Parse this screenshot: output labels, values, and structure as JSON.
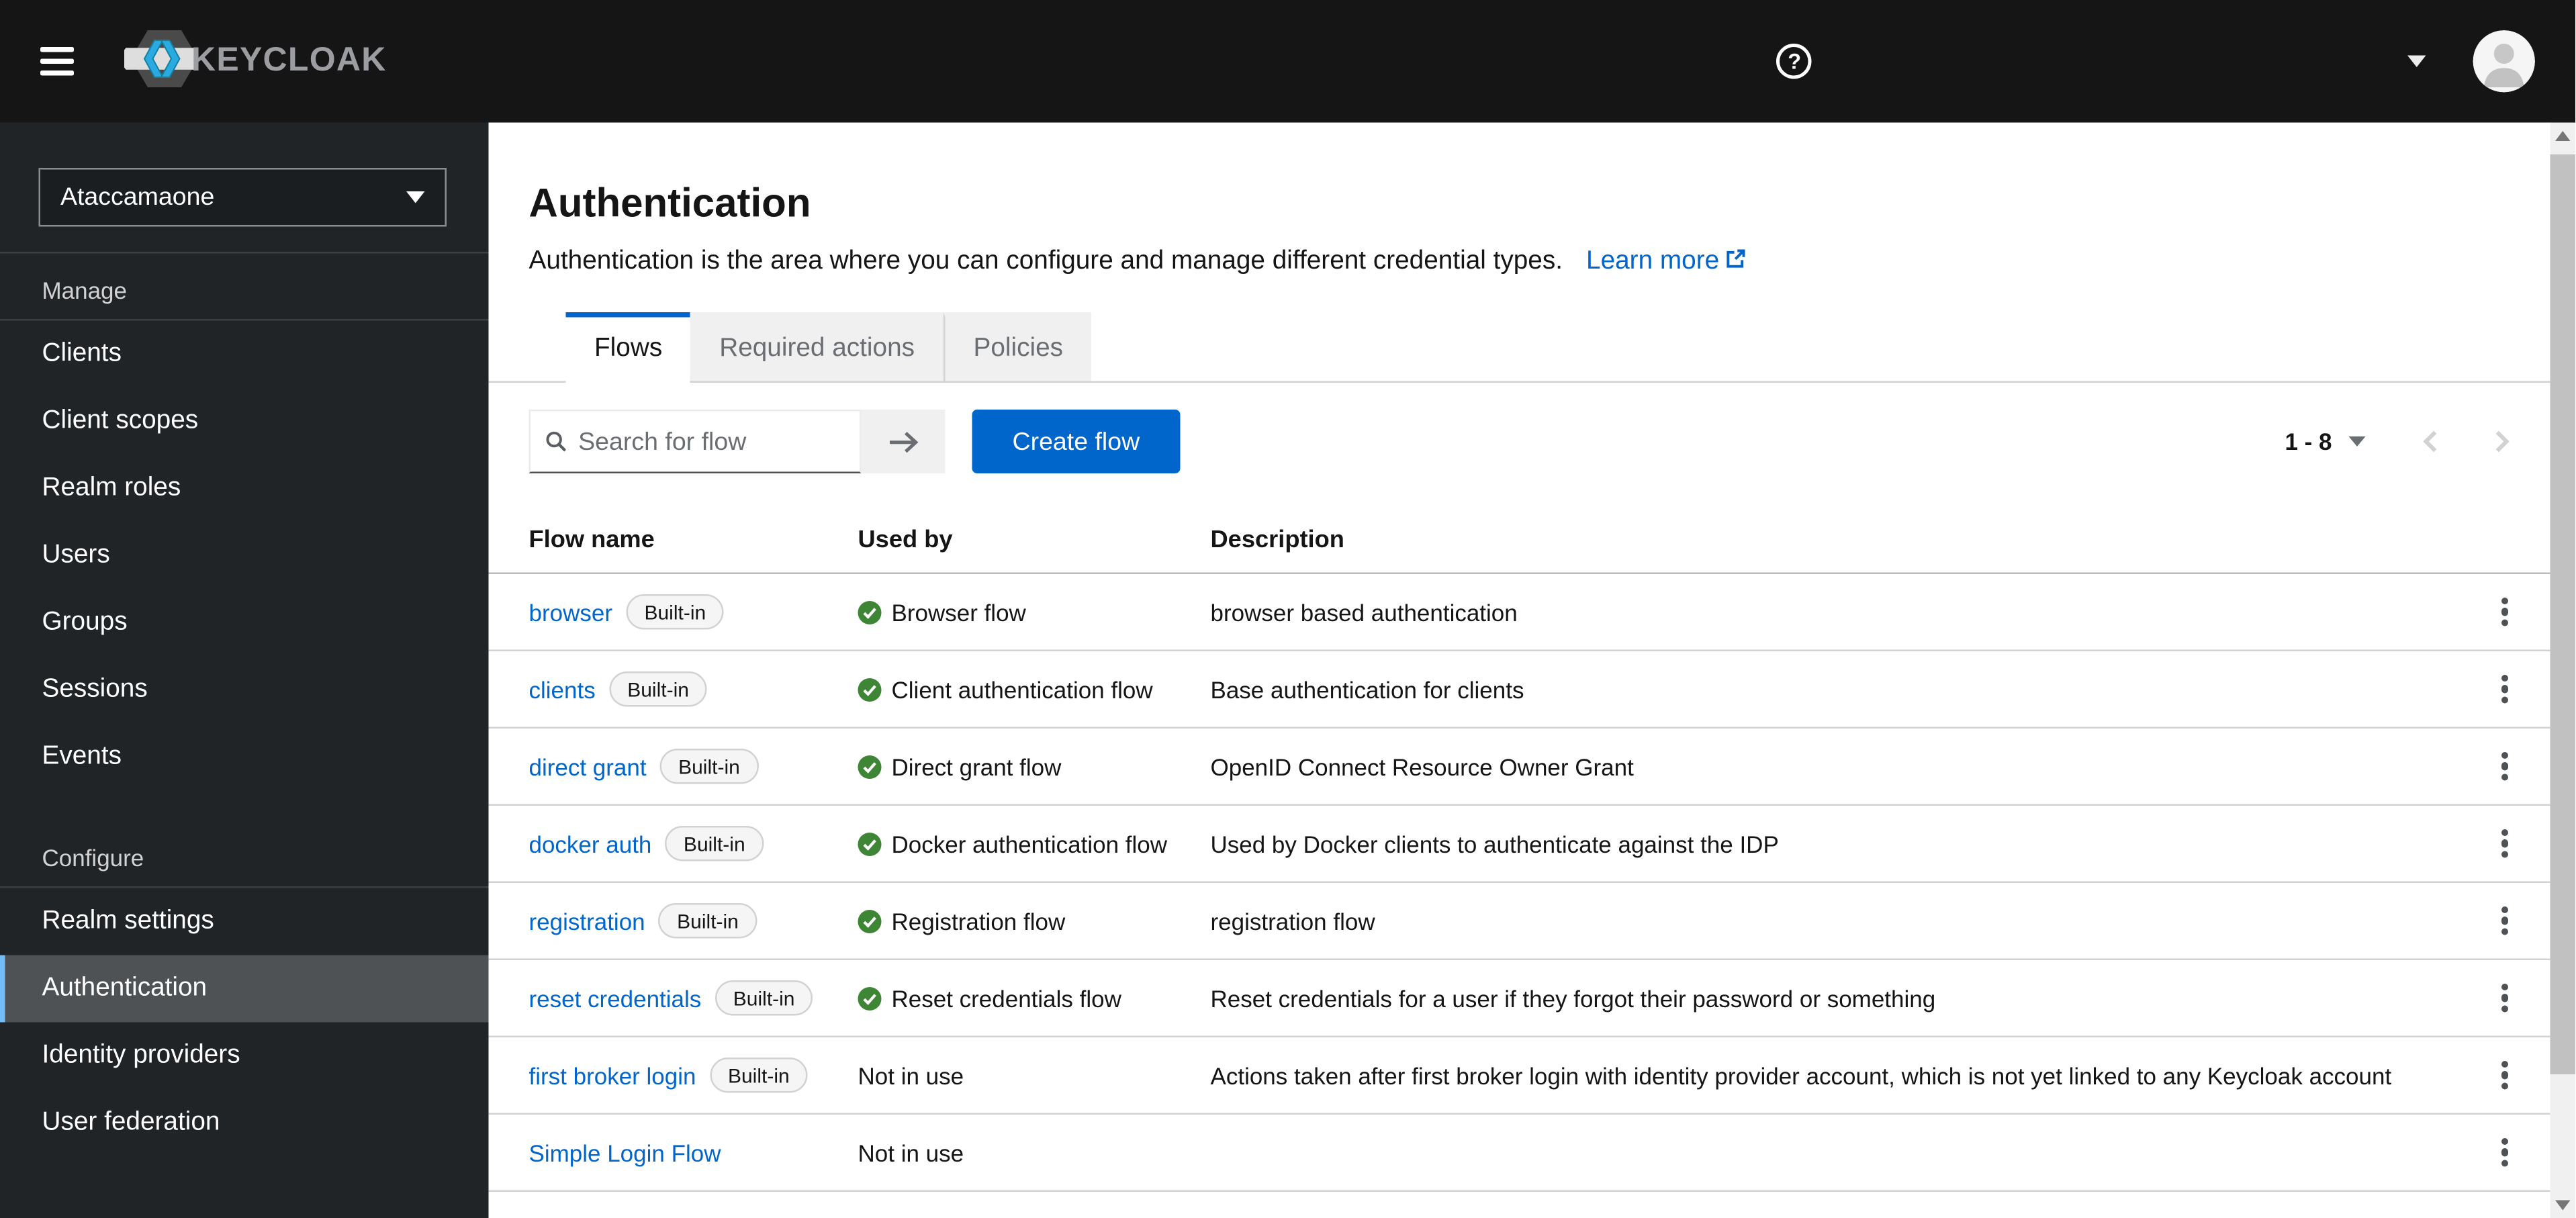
{
  "header": {
    "product_name": "KEYCLOAK",
    "help_glyph": "?"
  },
  "sidebar": {
    "realm_selector": {
      "value": "Ataccamaone"
    },
    "groups": [
      {
        "label": "Manage",
        "items": [
          {
            "label": "Clients",
            "active": false
          },
          {
            "label": "Client scopes",
            "active": false
          },
          {
            "label": "Realm roles",
            "active": false
          },
          {
            "label": "Users",
            "active": false
          },
          {
            "label": "Groups",
            "active": false
          },
          {
            "label": "Sessions",
            "active": false
          },
          {
            "label": "Events",
            "active": false
          }
        ]
      },
      {
        "label": "Configure",
        "items": [
          {
            "label": "Realm settings",
            "active": false
          },
          {
            "label": "Authentication",
            "active": true
          },
          {
            "label": "Identity providers",
            "active": false
          },
          {
            "label": "User federation",
            "active": false
          }
        ]
      }
    ]
  },
  "page": {
    "title": "Authentication",
    "description": "Authentication is the area where you can configure and manage different credential types.",
    "learn_more_label": "Learn more",
    "tabs": [
      {
        "label": "Flows",
        "active": true
      },
      {
        "label": "Required actions",
        "active": false
      },
      {
        "label": "Policies",
        "active": false
      }
    ],
    "toolbar": {
      "search_placeholder": "Search for flow",
      "create_button_label": "Create flow",
      "pagination": {
        "range": "1 - 8"
      }
    },
    "table": {
      "columns": [
        "Flow name",
        "Used by",
        "Description"
      ],
      "built_in_badge": "Built-in",
      "rows": [
        {
          "name": "browser",
          "badge": "Built-in",
          "in_use": true,
          "used_by": "Browser flow",
          "description": "browser based authentication"
        },
        {
          "name": "clients",
          "badge": "Built-in",
          "in_use": true,
          "used_by": "Client authentication flow",
          "description": "Base authentication for clients"
        },
        {
          "name": "direct grant",
          "badge": "Built-in",
          "in_use": true,
          "used_by": "Direct grant flow",
          "description": "OpenID Connect Resource Owner Grant"
        },
        {
          "name": "docker auth",
          "badge": "Built-in",
          "in_use": true,
          "used_by": "Docker authentication flow",
          "description": "Used by Docker clients to authenticate against the IDP"
        },
        {
          "name": "registration",
          "badge": "Built-in",
          "in_use": true,
          "used_by": "Registration flow",
          "description": "registration flow"
        },
        {
          "name": "reset credentials",
          "badge": "Built-in",
          "in_use": true,
          "used_by": "Reset credentials flow",
          "description": "Reset credentials for a user if they forgot their password or something"
        },
        {
          "name": "first broker login",
          "badge": "Built-in",
          "in_use": false,
          "used_by": "Not in use",
          "description": "Actions taken after first broker login with identity provider account, which is not yet linked to any Keycloak account"
        },
        {
          "name": "Simple Login Flow",
          "badge": null,
          "in_use": false,
          "used_by": "Not in use",
          "description": ""
        }
      ]
    }
  },
  "colors": {
    "header_bg": "#151515",
    "sidebar_bg": "#212427",
    "active_item_bg": "#4f5255",
    "active_item_accent": "#73bcf7",
    "accent_blue": "#0066cc",
    "link_blue": "#0066cc",
    "success_green": "#3e8635",
    "tab_inactive_bg": "#f0f0f0",
    "border_gray": "#d2d2d2",
    "badge_bg": "#f5f5f5",
    "logo_cyan": "#29abe2"
  }
}
